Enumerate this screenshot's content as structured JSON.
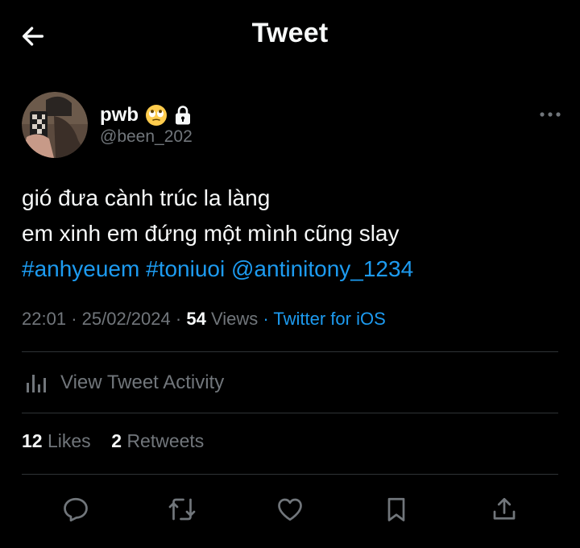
{
  "header": {
    "title": "Tweet"
  },
  "user": {
    "display_name": "pwb",
    "emoji": "🙄",
    "handle": "@been_202"
  },
  "tweet": {
    "line1": "gió đưa cành trúc la làng",
    "line2": "em xinh em đứng một mình cũng slay",
    "hashtag1": "#anhyeuem",
    "hashtag2": "#toniuoi",
    "mention": "@antinitony_1234"
  },
  "meta": {
    "time": "22:01",
    "date": "25/02/2024",
    "views_count": "54",
    "views_label": "Views",
    "source": "Twitter for iOS"
  },
  "activity": {
    "label": "View Tweet Activity"
  },
  "stats": {
    "likes_count": "12",
    "likes_label": "Likes",
    "retweets_count": "2",
    "retweets_label": "Retweets"
  },
  "colors": {
    "background": "#000000",
    "text_primary": "#e7e9ea",
    "text_secondary": "#71767b",
    "accent": "#1d9bf0",
    "divider": "#2f3336"
  },
  "icons": {
    "back": "arrow-left-icon",
    "lock": "lock-icon",
    "more": "more-horizontal-icon",
    "activity": "bar-chart-icon",
    "reply": "reply-icon",
    "retweet": "retweet-icon",
    "like": "heart-icon",
    "bookmark": "bookmark-icon",
    "share": "share-icon"
  }
}
